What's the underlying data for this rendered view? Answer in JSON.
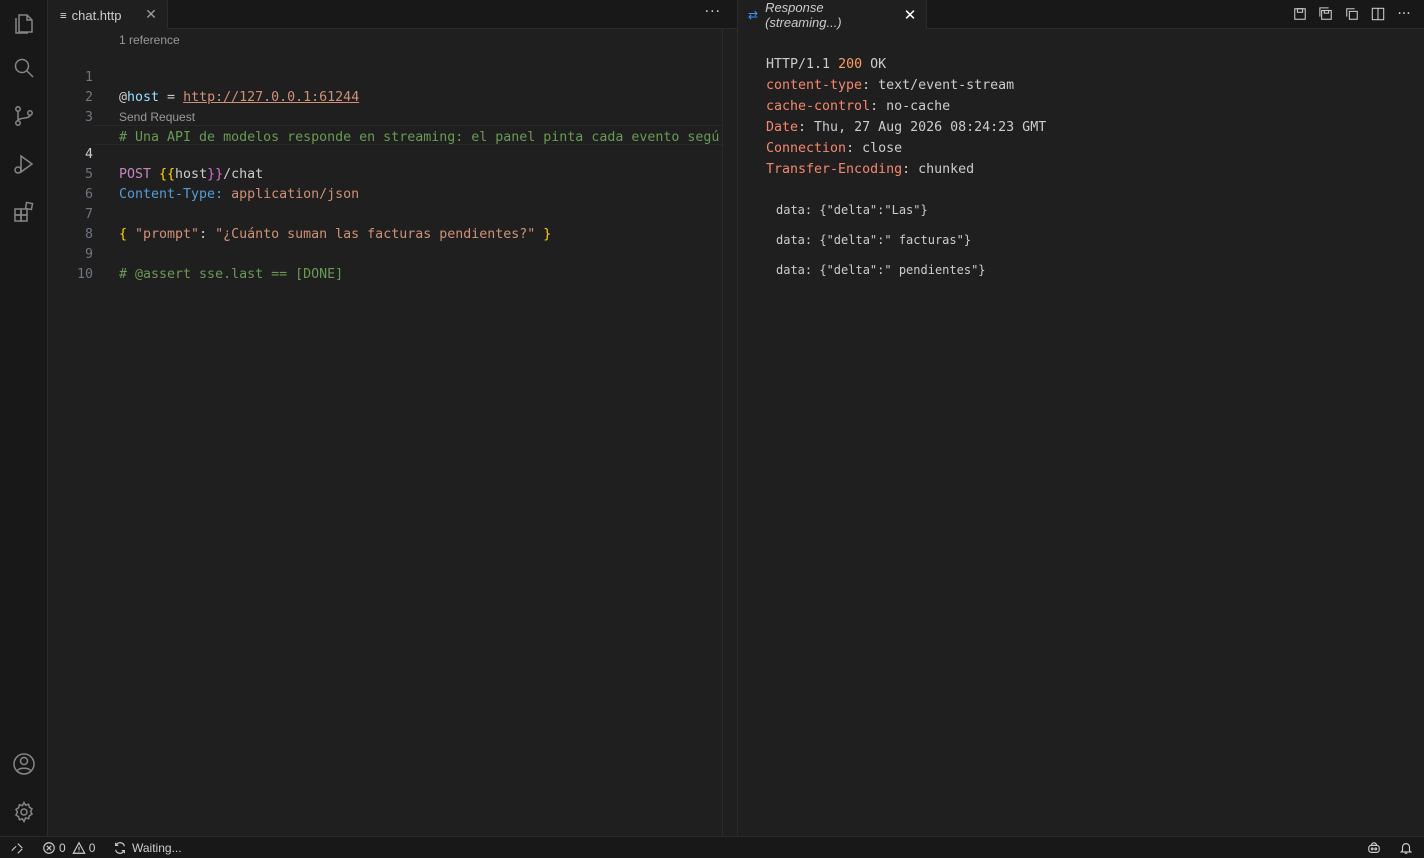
{
  "activity_bar": {
    "items": [
      {
        "name": "explorer-icon"
      },
      {
        "name": "search-icon"
      },
      {
        "name": "source-control-icon"
      },
      {
        "name": "run-debug-icon"
      },
      {
        "name": "extensions-icon"
      }
    ],
    "bottom": [
      {
        "name": "account-icon"
      },
      {
        "name": "gear-icon"
      }
    ]
  },
  "left_editor": {
    "tab": {
      "label": "chat.http",
      "close": "✕"
    },
    "more_actions": "···",
    "code_lens": {
      "references": "1 reference",
      "send_request": "Send Request"
    },
    "line_numbers": [
      "1",
      "2",
      "3",
      "4",
      "5",
      "6",
      "7",
      "8",
      "9",
      "10"
    ],
    "lines": {
      "l1": {
        "at": "@",
        "var": "host",
        "eq": " = ",
        "url": "http://127.0.0.1:61244"
      },
      "l3": {
        "comment": "# Una API de modelos responde en streaming: el panel pinta cada evento segú"
      },
      "l4": {
        "method": "POST ",
        "open": "{{",
        "var": "host",
        "close": "}}",
        "path": "/chat"
      },
      "l5": {
        "header": "Content-Type:",
        "value": " application/json"
      },
      "l7": {
        "open": "{ ",
        "key": "\"prompt\"",
        "colon": ": ",
        "value": "\"¿Cuánto suman las facturas pendientes?\"",
        "close": " }"
      },
      "l9": {
        "comment": "# @assert sse.last == [DONE]"
      }
    }
  },
  "right_editor": {
    "tab": {
      "label": "Response (streaming...)",
      "swap": "⇄",
      "close": "✕"
    },
    "response": {
      "proto": "HTTP/1.1 ",
      "status": "200",
      "status_text": " OK",
      "headers": [
        {
          "key": "content-type",
          "value": "text/event-stream"
        },
        {
          "key": "cache-control",
          "value": "no-cache"
        },
        {
          "key": "Date",
          "value": "Thu, 27 Aug 2026 08:24:23 GMT"
        },
        {
          "key": "Connection",
          "value": "close"
        },
        {
          "key": "Transfer-Encoding",
          "value": "chunked"
        }
      ],
      "events": [
        "data: {\"delta\":\"Las\"}",
        "data: {\"delta\":\" facturas\"}",
        "data: {\"delta\":\" pendientes\"}"
      ]
    }
  },
  "status_bar": {
    "errors": "0",
    "warnings": "0",
    "sync_text": "Waiting..."
  }
}
